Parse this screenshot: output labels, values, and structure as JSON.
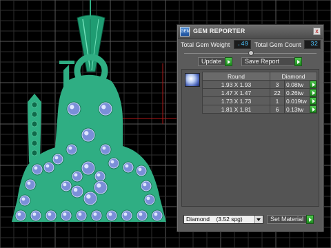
{
  "panel": {
    "title": "GEM REPORTER",
    "app_icon_text": "GEM",
    "close_label": "x",
    "total_weight_label": "Total Gem Weight",
    "total_weight_value": ".49",
    "total_count_label": "Total Gem Count",
    "total_count_value": "32",
    "update_label": "Update",
    "save_report_label": "Save Report",
    "table": {
      "headers": [
        "Round",
        "Diamond"
      ],
      "rows": [
        {
          "size": "1.93 X 1.93",
          "count": "3",
          "weight": "0.08tw"
        },
        {
          "size": "1.47 X 1.47",
          "count": "22",
          "weight": "0.26tw"
        },
        {
          "size": "1.73 X 1.73",
          "count": "1",
          "weight": "0.019tw"
        },
        {
          "size": "1.81 X 1.81",
          "count": "6",
          "weight": "0.13tw"
        }
      ]
    },
    "material_select_value": "Diamond    (3.52 spg)",
    "set_material_label": "Set Material"
  },
  "colors": {
    "viewport_bg": "#000000",
    "grid_line": "#3b3b3b",
    "grid_major": "#6a6a6a",
    "pendant_fill": "#2fae83",
    "bail_fill": "#1e9e72",
    "gem_blue": "#6f86d6",
    "accent_green": "#2fbf2f",
    "readout_blue": "#4fc6ff"
  }
}
